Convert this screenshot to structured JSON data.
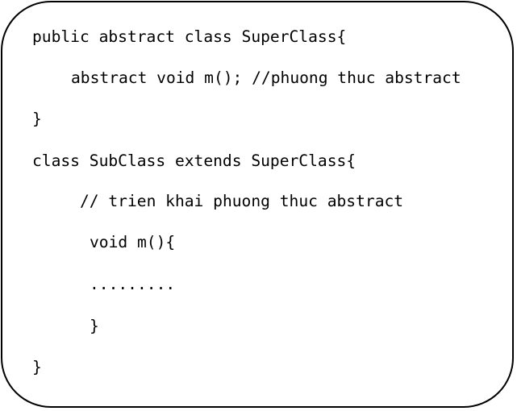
{
  "code_lines": [
    "public abstract class SuperClass{",
    "abstract void m(); //phuong thuc abstract",
    "}",
    "class SubClass extends SuperClass{",
    "// trien khai phuong thuc abstract",
    "void m(){",
    ".........",
    "}",
    "}"
  ]
}
